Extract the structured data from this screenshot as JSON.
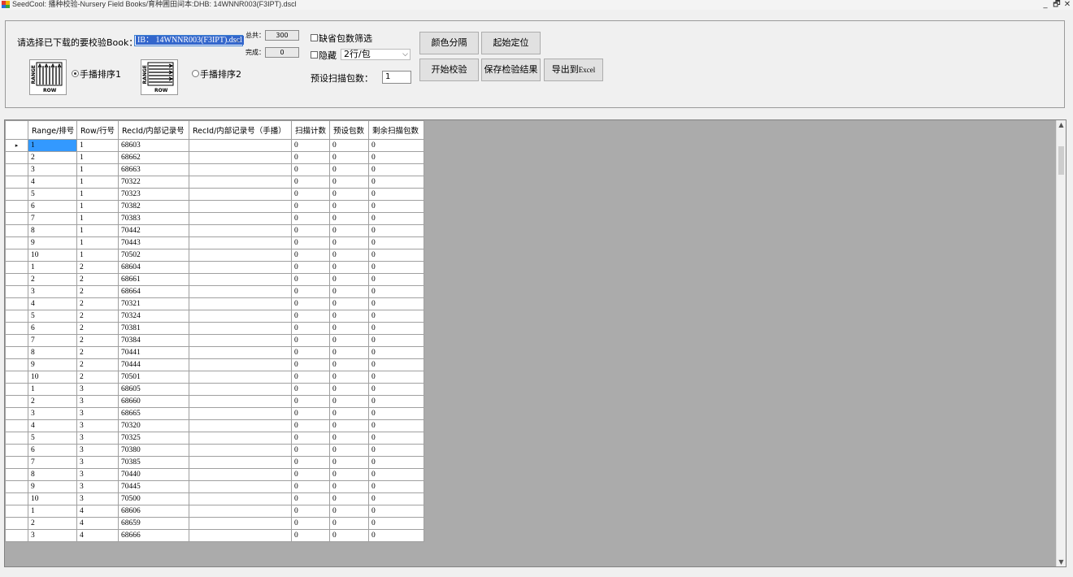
{
  "window": {
    "title": "SeedCool: 播种校验-Nursery Field Books/育种圃田间本:DHB:  14WNNR003(F3IPT).dscl",
    "minimize": "_",
    "restore": "🗗",
    "close": "✕"
  },
  "controls": {
    "book_label": "请选择已下载的要校验Book：",
    "book_value": "IB： 14WNNR003(F3IPT).dscl",
    "total_label": "总共：",
    "total_value": "300",
    "done_label": "完成：",
    "done_value": "0",
    "missing_filter_label": "缺省包数筛选",
    "hide_label": "隐藏",
    "rows_per_pack_value": "2行/包",
    "preset_scan_label": "预设扫描包数：",
    "preset_scan_value": "1",
    "manual_sort_1_label": "手播排序1",
    "manual_sort_2_label": "手播排序2",
    "diagram_range": "RANGE",
    "diagram_row": "ROW",
    "btn_color_separate": "颜色分隔",
    "btn_start_position": "起始定位",
    "btn_start_check": "开始校验",
    "btn_save_results": "保存检验结果",
    "btn_export_prefix": "导出到",
    "btn_export_suffix": "Excel"
  },
  "table": {
    "columns": [
      "Range/排号",
      "Row/行号",
      "RecId/内部记录号",
      "RecId/内部记录号（手播）",
      "扫描计数",
      "预设包数",
      "剩余扫描包数"
    ],
    "rows": [
      [
        "1",
        "1",
        "68603",
        "",
        "0",
        "0",
        "0"
      ],
      [
        "2",
        "1",
        "68662",
        "",
        "0",
        "0",
        "0"
      ],
      [
        "3",
        "1",
        "68663",
        "",
        "0",
        "0",
        "0"
      ],
      [
        "4",
        "1",
        "70322",
        "",
        "0",
        "0",
        "0"
      ],
      [
        "5",
        "1",
        "70323",
        "",
        "0",
        "0",
        "0"
      ],
      [
        "6",
        "1",
        "70382",
        "",
        "0",
        "0",
        "0"
      ],
      [
        "7",
        "1",
        "70383",
        "",
        "0",
        "0",
        "0"
      ],
      [
        "8",
        "1",
        "70442",
        "",
        "0",
        "0",
        "0"
      ],
      [
        "9",
        "1",
        "70443",
        "",
        "0",
        "0",
        "0"
      ],
      [
        "10",
        "1",
        "70502",
        "",
        "0",
        "0",
        "0"
      ],
      [
        "1",
        "2",
        "68604",
        "",
        "0",
        "0",
        "0"
      ],
      [
        "2",
        "2",
        "68661",
        "",
        "0",
        "0",
        "0"
      ],
      [
        "3",
        "2",
        "68664",
        "",
        "0",
        "0",
        "0"
      ],
      [
        "4",
        "2",
        "70321",
        "",
        "0",
        "0",
        "0"
      ],
      [
        "5",
        "2",
        "70324",
        "",
        "0",
        "0",
        "0"
      ],
      [
        "6",
        "2",
        "70381",
        "",
        "0",
        "0",
        "0"
      ],
      [
        "7",
        "2",
        "70384",
        "",
        "0",
        "0",
        "0"
      ],
      [
        "8",
        "2",
        "70441",
        "",
        "0",
        "0",
        "0"
      ],
      [
        "9",
        "2",
        "70444",
        "",
        "0",
        "0",
        "0"
      ],
      [
        "10",
        "2",
        "70501",
        "",
        "0",
        "0",
        "0"
      ],
      [
        "1",
        "3",
        "68605",
        "",
        "0",
        "0",
        "0"
      ],
      [
        "2",
        "3",
        "68660",
        "",
        "0",
        "0",
        "0"
      ],
      [
        "3",
        "3",
        "68665",
        "",
        "0",
        "0",
        "0"
      ],
      [
        "4",
        "3",
        "70320",
        "",
        "0",
        "0",
        "0"
      ],
      [
        "5",
        "3",
        "70325",
        "",
        "0",
        "0",
        "0"
      ],
      [
        "6",
        "3",
        "70380",
        "",
        "0",
        "0",
        "0"
      ],
      [
        "7",
        "3",
        "70385",
        "",
        "0",
        "0",
        "0"
      ],
      [
        "8",
        "3",
        "70440",
        "",
        "0",
        "0",
        "0"
      ],
      [
        "9",
        "3",
        "70445",
        "",
        "0",
        "0",
        "0"
      ],
      [
        "10",
        "3",
        "70500",
        "",
        "0",
        "0",
        "0"
      ],
      [
        "1",
        "4",
        "68606",
        "",
        "0",
        "0",
        "0"
      ],
      [
        "2",
        "4",
        "68659",
        "",
        "0",
        "0",
        "0"
      ],
      [
        "3",
        "4",
        "68666",
        "",
        "0",
        "0",
        "0"
      ]
    ],
    "current_row_marker": "▸"
  }
}
